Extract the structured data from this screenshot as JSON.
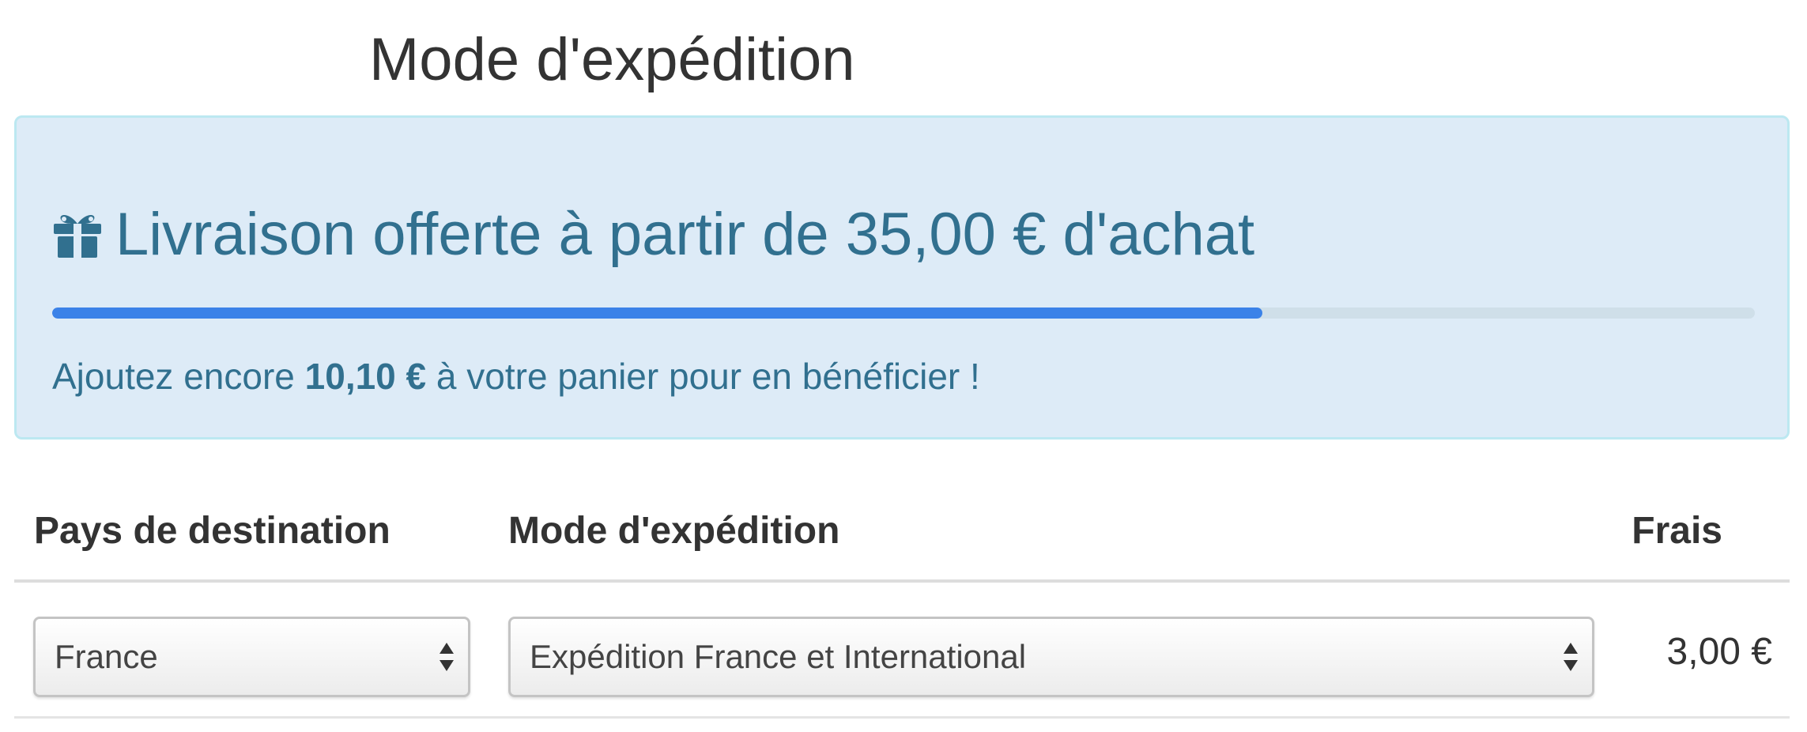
{
  "page_title": "Mode d'expédition",
  "promo": {
    "icon": "gift-icon",
    "heading": "Livraison offerte à partir de 35,00 € d'achat",
    "progress_fraction": 0.711,
    "progress_color": "#3b82e8",
    "text_before": "Ajoutez encore",
    "remaining_amount": "10,10 €",
    "text_after": "à votre panier pour en bénéficier !"
  },
  "table": {
    "headers": {
      "country": "Pays de destination",
      "method": "Mode d'expédition",
      "fee": "Frais"
    },
    "row": {
      "country_selected": "France",
      "method_selected": "Expédition France et International",
      "fee": "3,00 €"
    }
  },
  "colors": {
    "promo_background": "#ddebf7",
    "promo_text": "#31708f"
  }
}
